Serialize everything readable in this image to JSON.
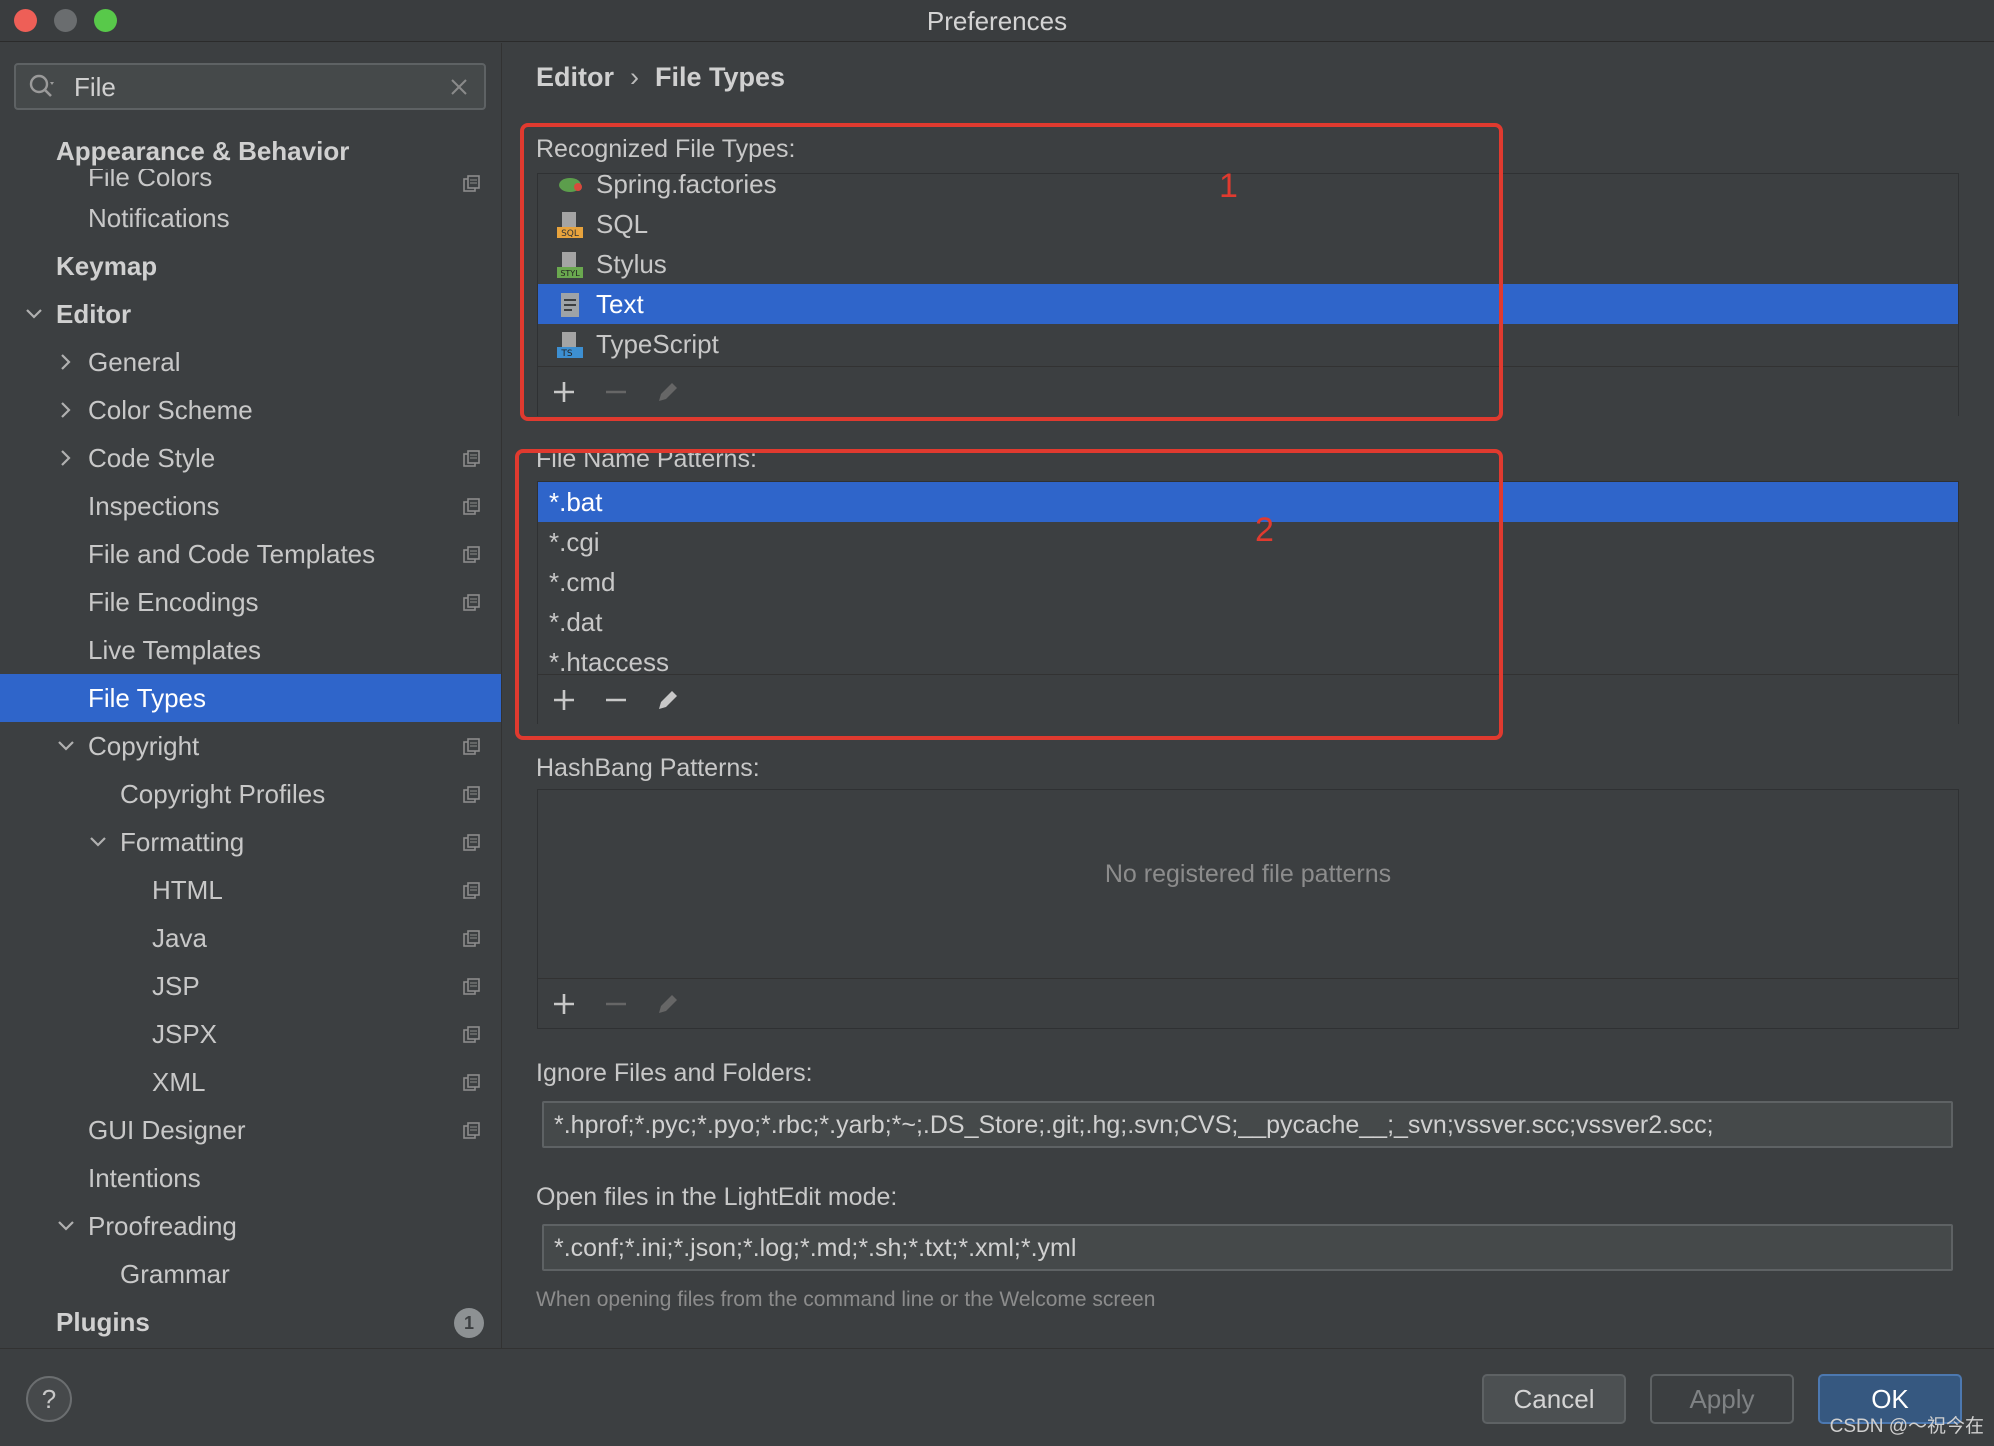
{
  "window": {
    "title": "Preferences"
  },
  "search": {
    "value": "File"
  },
  "sidebar": {
    "items": [
      {
        "label": "Appearance & Behavior"
      },
      {
        "label": "File Colors"
      },
      {
        "label": "Notifications"
      },
      {
        "label": "Keymap"
      },
      {
        "label": "Editor"
      },
      {
        "label": "General"
      },
      {
        "label": "Color Scheme"
      },
      {
        "label": "Code Style"
      },
      {
        "label": "Inspections"
      },
      {
        "label": "File and Code Templates"
      },
      {
        "label": "File Encodings"
      },
      {
        "label": "Live Templates"
      },
      {
        "label": "File Types"
      },
      {
        "label": "Copyright"
      },
      {
        "label": "Copyright Profiles"
      },
      {
        "label": "Formatting"
      },
      {
        "label": "HTML"
      },
      {
        "label": "Java"
      },
      {
        "label": "JSP"
      },
      {
        "label": "JSPX"
      },
      {
        "label": "XML"
      },
      {
        "label": "GUI Designer"
      },
      {
        "label": "Intentions"
      },
      {
        "label": "Proofreading"
      },
      {
        "label": "Grammar"
      },
      {
        "label": "Plugins",
        "badge": "1"
      }
    ]
  },
  "breadcrumb": {
    "parent": "Editor",
    "separator": "›",
    "current": "File Types"
  },
  "recognized": {
    "label": "Recognized File Types:",
    "items": [
      {
        "label": "Spring.factories",
        "icon": "spring-file-icon"
      },
      {
        "label": "SQL",
        "icon": "sql-file-icon"
      },
      {
        "label": "Stylus",
        "icon": "stylus-file-icon"
      },
      {
        "label": "Text",
        "icon": "text-file-icon",
        "selected": true
      },
      {
        "label": "TypeScript",
        "icon": "typescript-file-icon"
      }
    ]
  },
  "patterns": {
    "label": "File Name Patterns:",
    "items": [
      "*.bat",
      "*.cgi",
      "*.cmd",
      "*.dat",
      "*.htaccess"
    ],
    "selected": "*.bat"
  },
  "hashbang": {
    "label": "HashBang Patterns:",
    "empty_text": "No registered file patterns"
  },
  "ignore": {
    "label": "Ignore Files and Folders:",
    "value": "*.hprof;*.pyc;*.pyo;*.rbc;*.yarb;*~;.DS_Store;.git;.hg;.svn;CVS;__pycache__;_svn;vssver.scc;vssver2.scc;"
  },
  "lightedit": {
    "label": "Open files in the LightEdit mode:",
    "value": "*.conf;*.ini;*.json;*.log;*.md;*.sh;*.txt;*.xml;*.yml",
    "hint": "When opening files from the command line or the Welcome screen"
  },
  "annotations": {
    "box1": "1",
    "box2": "2"
  },
  "footer": {
    "help": "?",
    "cancel": "Cancel",
    "apply": "Apply",
    "ok": "OK"
  },
  "watermark": "CSDN @～祝今在",
  "colors": {
    "selection": "#2f65ca",
    "annotation": "#e03a2f",
    "background": "#3c3f41"
  }
}
